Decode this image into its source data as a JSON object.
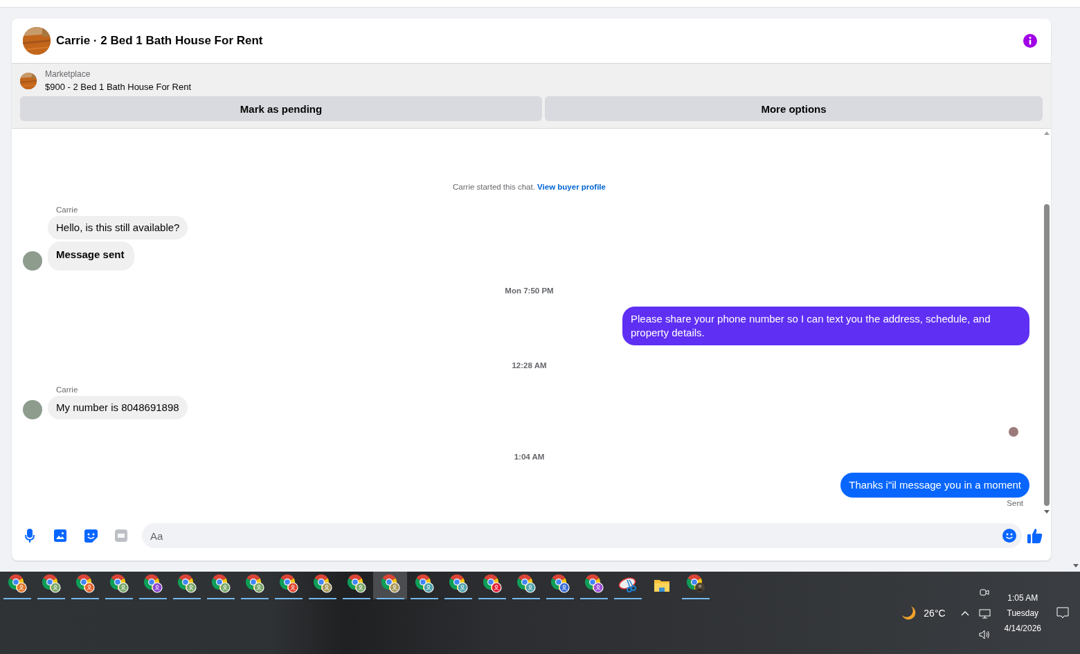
{
  "conversation": {
    "title": "Carrie · 2 Bed 1 Bath House For Rent"
  },
  "listing": {
    "label": "Marketplace",
    "name": "$900 - 2 Bed 1 Bath House For Rent",
    "actions": [
      "Mark as pending",
      "More options"
    ]
  },
  "messages": [
    {
      "kind": "notice",
      "text": "Carrie started this chat.",
      "link": "View buyer profile"
    },
    {
      "kind": "incoming",
      "sender": "Carrie",
      "bubbles": [
        {
          "text": "Hello, is this still available?",
          "bold": false
        },
        {
          "text": "Message sent",
          "bold": true
        }
      ]
    },
    {
      "kind": "time",
      "text": "Mon 7:50 PM"
    },
    {
      "kind": "outgoing",
      "bubbles": [
        {
          "text": "Please share your phone number so I can text you the address, schedule, and property details.",
          "color": "#5f2ff3"
        }
      ]
    },
    {
      "kind": "time",
      "text": "12:28 AM"
    },
    {
      "kind": "incoming",
      "sender": "Carrie",
      "bubbles": [
        {
          "text": "My number is 8048691898",
          "bold": false
        }
      ]
    },
    {
      "kind": "seen"
    },
    {
      "kind": "time",
      "text": "1:04 AM"
    },
    {
      "kind": "outgoing",
      "bubbles": [
        {
          "text": "Thanks i\"il message you in a moment",
          "color": "#0866ff"
        }
      ],
      "status": "Sent"
    }
  ],
  "composer": {
    "placeholder": "Aa"
  },
  "taskbar": {
    "apps": [
      {
        "kind": "chrome",
        "color": "#e0782a",
        "running": true,
        "selected": false
      },
      {
        "kind": "chrome",
        "color": "#7aa86a",
        "running": true,
        "selected": false
      },
      {
        "kind": "chrome",
        "color": "#e2612d",
        "running": true,
        "selected": false
      },
      {
        "kind": "chrome",
        "color": "#7aa86a",
        "running": true,
        "selected": false
      },
      {
        "kind": "chrome",
        "color": "#8b45d1",
        "running": true,
        "selected": false
      },
      {
        "kind": "chrome",
        "color": "#7aa86a",
        "running": true,
        "selected": false
      },
      {
        "kind": "chrome",
        "color": "#7aa86a",
        "running": true,
        "selected": false
      },
      {
        "kind": "chrome",
        "color": "#7aa86a",
        "running": true,
        "selected": false
      },
      {
        "kind": "chrome",
        "color": "#e2452d",
        "running": true,
        "selected": false
      },
      {
        "kind": "chrome",
        "color": "#a99a5e",
        "running": true,
        "selected": false
      },
      {
        "kind": "chrome",
        "color": "#7aa86a",
        "running": true,
        "selected": false
      },
      {
        "kind": "chrome",
        "color": "#a99a5e",
        "running": true,
        "selected": true
      },
      {
        "kind": "chrome",
        "color": "#4fa3ad",
        "running": true,
        "selected": false
      },
      {
        "kind": "chrome",
        "color": "#4fa3ad",
        "running": true,
        "selected": false
      },
      {
        "kind": "chrome",
        "color": "#e0203a",
        "running": true,
        "selected": false
      },
      {
        "kind": "chrome",
        "color": "#4fa3ad",
        "running": true,
        "selected": false
      },
      {
        "kind": "chrome",
        "color": "#3d6fd6",
        "running": true,
        "selected": false
      },
      {
        "kind": "chrome",
        "color": "#9d4fd6",
        "running": true,
        "selected": false
      },
      {
        "kind": "snip",
        "running": true,
        "selected": false
      },
      {
        "kind": "folder",
        "running": false,
        "selected": false
      },
      {
        "kind": "chrome-photo",
        "running": true,
        "selected": false
      }
    ],
    "weather": "26°C",
    "time": "1:05 AM",
    "day": "Tuesday",
    "date": "4/14/2026"
  }
}
